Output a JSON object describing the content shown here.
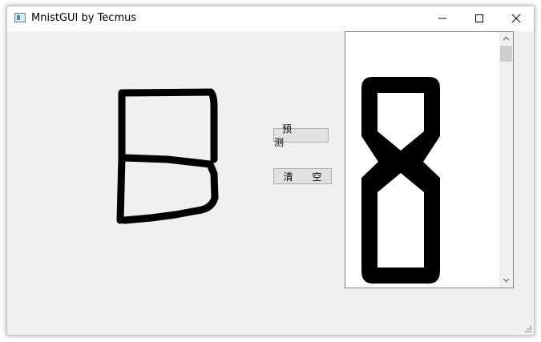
{
  "window": {
    "title": "MnistGUI by Tecmus"
  },
  "buttons": {
    "predict": "预 测",
    "clear": "清 空"
  },
  "result": {
    "digit": "8"
  },
  "icons": {
    "app": "app-window-icon",
    "minimize": "minimize-icon",
    "maximize": "maximize-icon",
    "close": "close-icon",
    "scroll_up": "chevron-up-icon",
    "scroll_down": "chevron-down-icon",
    "grip": "resize-grip-icon"
  }
}
